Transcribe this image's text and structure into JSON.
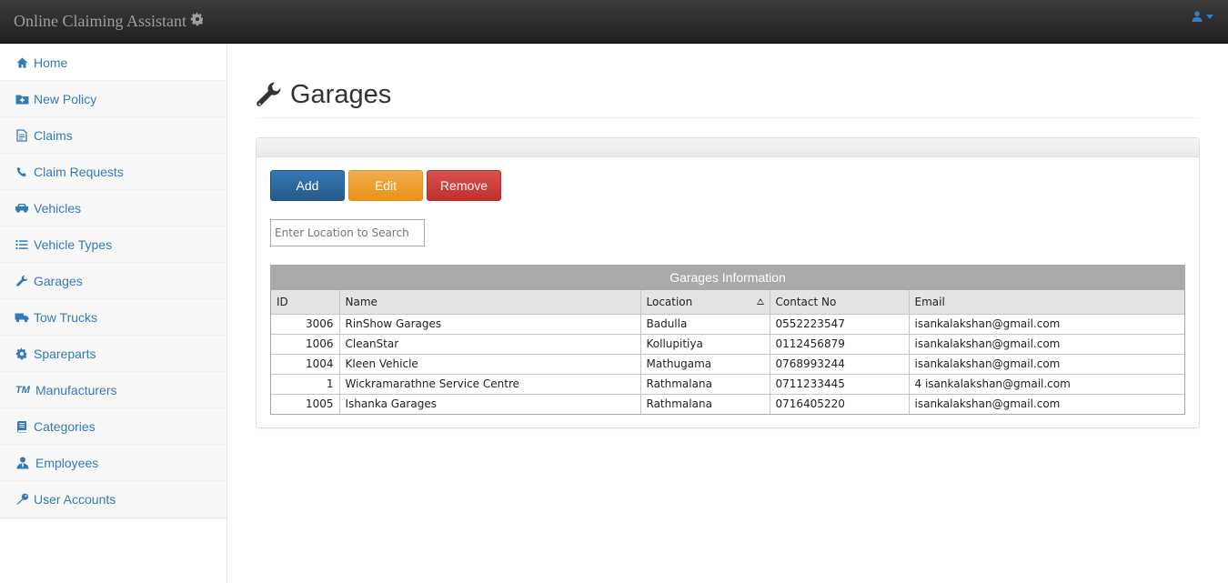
{
  "navbar": {
    "brand": "Online Claiming Assistant",
    "brand_icon": "gear-icon",
    "user_icon": "user-icon"
  },
  "sidebar": {
    "items": [
      {
        "label": "Home",
        "icon": "home-icon"
      },
      {
        "label": "New Policy",
        "icon": "folder-plus-icon"
      },
      {
        "label": "Claims",
        "icon": "document-icon"
      },
      {
        "label": "Claim Requests",
        "icon": "phone-icon"
      },
      {
        "label": "Vehicles",
        "icon": "car-icon"
      },
      {
        "label": "Vehicle Types",
        "icon": "list-icon"
      },
      {
        "label": "Garages",
        "icon": "wrench-icon"
      },
      {
        "label": "Tow Trucks",
        "icon": "truck-icon"
      },
      {
        "label": "Spareparts",
        "icon": "gear-icon"
      },
      {
        "label": "Manufacturers",
        "icon": "trademark-icon"
      },
      {
        "label": "Categories",
        "icon": "book-icon"
      },
      {
        "label": "Employees",
        "icon": "user-tie-icon"
      },
      {
        "label": "User Accounts",
        "icon": "key-icon"
      }
    ]
  },
  "page": {
    "title": "Garages",
    "title_icon": "wrench-icon"
  },
  "toolbar": {
    "add_label": "Add",
    "edit_label": "Edit",
    "remove_label": "Remove"
  },
  "search": {
    "placeholder": "Enter Location to Search"
  },
  "grid": {
    "caption": "Garages Information",
    "columns": [
      "ID",
      "Name",
      "Location",
      "Contact No",
      "Email"
    ],
    "sorted_column": "Location",
    "rows": [
      [
        "3006",
        "RinShow Garages",
        "Badulla",
        "0552223547",
        "isankalakshan@gmail.com"
      ],
      [
        "1006",
        "CleanStar",
        "Kollupitiya",
        "0112456879",
        "isankalakshan@gmail.com"
      ],
      [
        "1004",
        "Kleen Vehicle",
        "Mathugama",
        "0768993244",
        "isankalakshan@gmail.com"
      ],
      [
        "1",
        "Wickramarathne Service Centre",
        "Rathmalana",
        "0711233445",
        "4 isankalakshan@gmail.com"
      ],
      [
        "1005",
        "Ishanka Garages",
        "Rathmalana",
        "0716405220",
        "isankalakshan@gmail.com"
      ]
    ]
  },
  "colors": {
    "navbar": "#222222",
    "link": "#337ab7",
    "add": "#337ab7",
    "edit": "#f0ad4e",
    "remove": "#d9534f",
    "grid_caption": "#a9a9a9"
  }
}
